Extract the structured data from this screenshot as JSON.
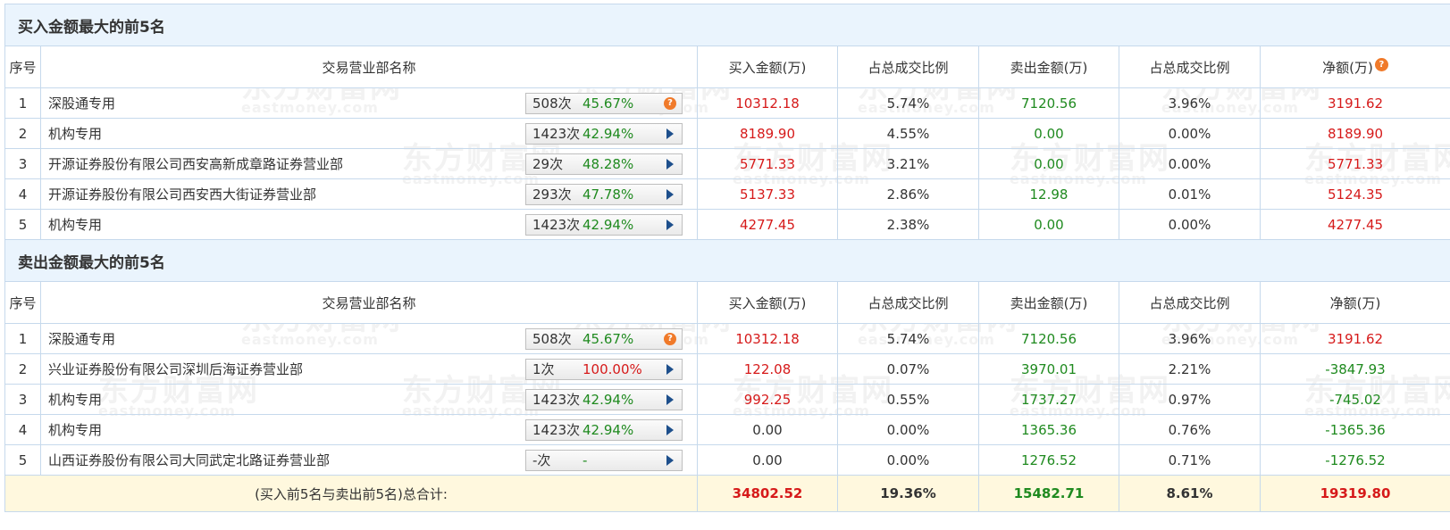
{
  "watermark": {
    "brand": "东方财富网",
    "domain": "eastmoney.com"
  },
  "columns": [
    "序号",
    "交易营业部名称",
    "买入金额(万)",
    "占总成交比例",
    "卖出金额(万)",
    "占总成交比例",
    "净额(万)"
  ],
  "buy_section": {
    "title": "买入金额最大的前5名",
    "rows": [
      {
        "idx": "1",
        "name": "深股通专用",
        "count": "508次",
        "pct": "45.67%",
        "icon": "question-icon",
        "buy": "10312.18",
        "buy_ratio": "5.74%",
        "sell": "7120.56",
        "sell_ratio": "3.96%",
        "net": "3191.62"
      },
      {
        "idx": "2",
        "name": "机构专用",
        "count": "1423次",
        "pct": "42.94%",
        "icon": "play-arrow-icon",
        "buy": "8189.90",
        "buy_ratio": "4.55%",
        "sell": "0.00",
        "sell_ratio": "0.00%",
        "net": "8189.90"
      },
      {
        "idx": "3",
        "name": "开源证券股份有限公司西安高新成章路证券营业部",
        "count": "29次",
        "pct": "48.28%",
        "icon": "play-arrow-icon",
        "buy": "5771.33",
        "buy_ratio": "3.21%",
        "sell": "0.00",
        "sell_ratio": "0.00%",
        "net": "5771.33"
      },
      {
        "idx": "4",
        "name": "开源证券股份有限公司西安西大街证券营业部",
        "count": "293次",
        "pct": "47.78%",
        "icon": "play-arrow-icon",
        "buy": "5137.33",
        "buy_ratio": "2.86%",
        "sell": "12.98",
        "sell_ratio": "0.01%",
        "net": "5124.35"
      },
      {
        "idx": "5",
        "name": "机构专用",
        "count": "1423次",
        "pct": "42.94%",
        "icon": "play-arrow-icon",
        "buy": "4277.45",
        "buy_ratio": "2.38%",
        "sell": "0.00",
        "sell_ratio": "0.00%",
        "net": "4277.45"
      }
    ]
  },
  "sell_section": {
    "title": "卖出金额最大的前5名",
    "rows": [
      {
        "idx": "1",
        "name": "深股通专用",
        "count": "508次",
        "pct": "45.67%",
        "icon": "question-icon",
        "buy": "10312.18",
        "buy_ratio": "5.74%",
        "sell": "7120.56",
        "sell_ratio": "3.96%",
        "net": "3191.62"
      },
      {
        "idx": "2",
        "name": "兴业证券股份有限公司深圳后海证券营业部",
        "count": "1次",
        "pct": "100.00%",
        "icon": "play-arrow-icon",
        "buy": "122.08",
        "buy_ratio": "0.07%",
        "sell": "3970.01",
        "sell_ratio": "2.21%",
        "net": "-3847.93"
      },
      {
        "idx": "3",
        "name": "机构专用",
        "count": "1423次",
        "pct": "42.94%",
        "icon": "play-arrow-icon",
        "buy": "992.25",
        "buy_ratio": "0.55%",
        "sell": "1737.27",
        "sell_ratio": "0.97%",
        "net": "-745.02"
      },
      {
        "idx": "4",
        "name": "机构专用",
        "count": "1423次",
        "pct": "42.94%",
        "icon": "play-arrow-icon",
        "buy": "0.00",
        "buy_ratio": "0.00%",
        "sell": "1365.36",
        "sell_ratio": "0.76%",
        "net": "-1365.36"
      },
      {
        "idx": "5",
        "name": "山西证券股份有限公司大同武定北路证券营业部",
        "count": "-次",
        "pct": "-",
        "icon": "play-arrow-icon",
        "buy": "0.00",
        "buy_ratio": "0.00%",
        "sell": "1276.52",
        "sell_ratio": "0.71%",
        "net": "-1276.52"
      }
    ]
  },
  "total": {
    "label": "(买入前5名与卖出前5名)总合计:",
    "buy": "34802.52",
    "buy_ratio": "19.36%",
    "sell": "15482.71",
    "sell_ratio": "8.61%",
    "net": "19319.80"
  },
  "colors": {
    "red": "#d61a1a",
    "green": "#1f8a1f",
    "header_bg": "#eaf4fd",
    "total_bg": "#fff8de",
    "help_icon": "#f07a2a"
  }
}
